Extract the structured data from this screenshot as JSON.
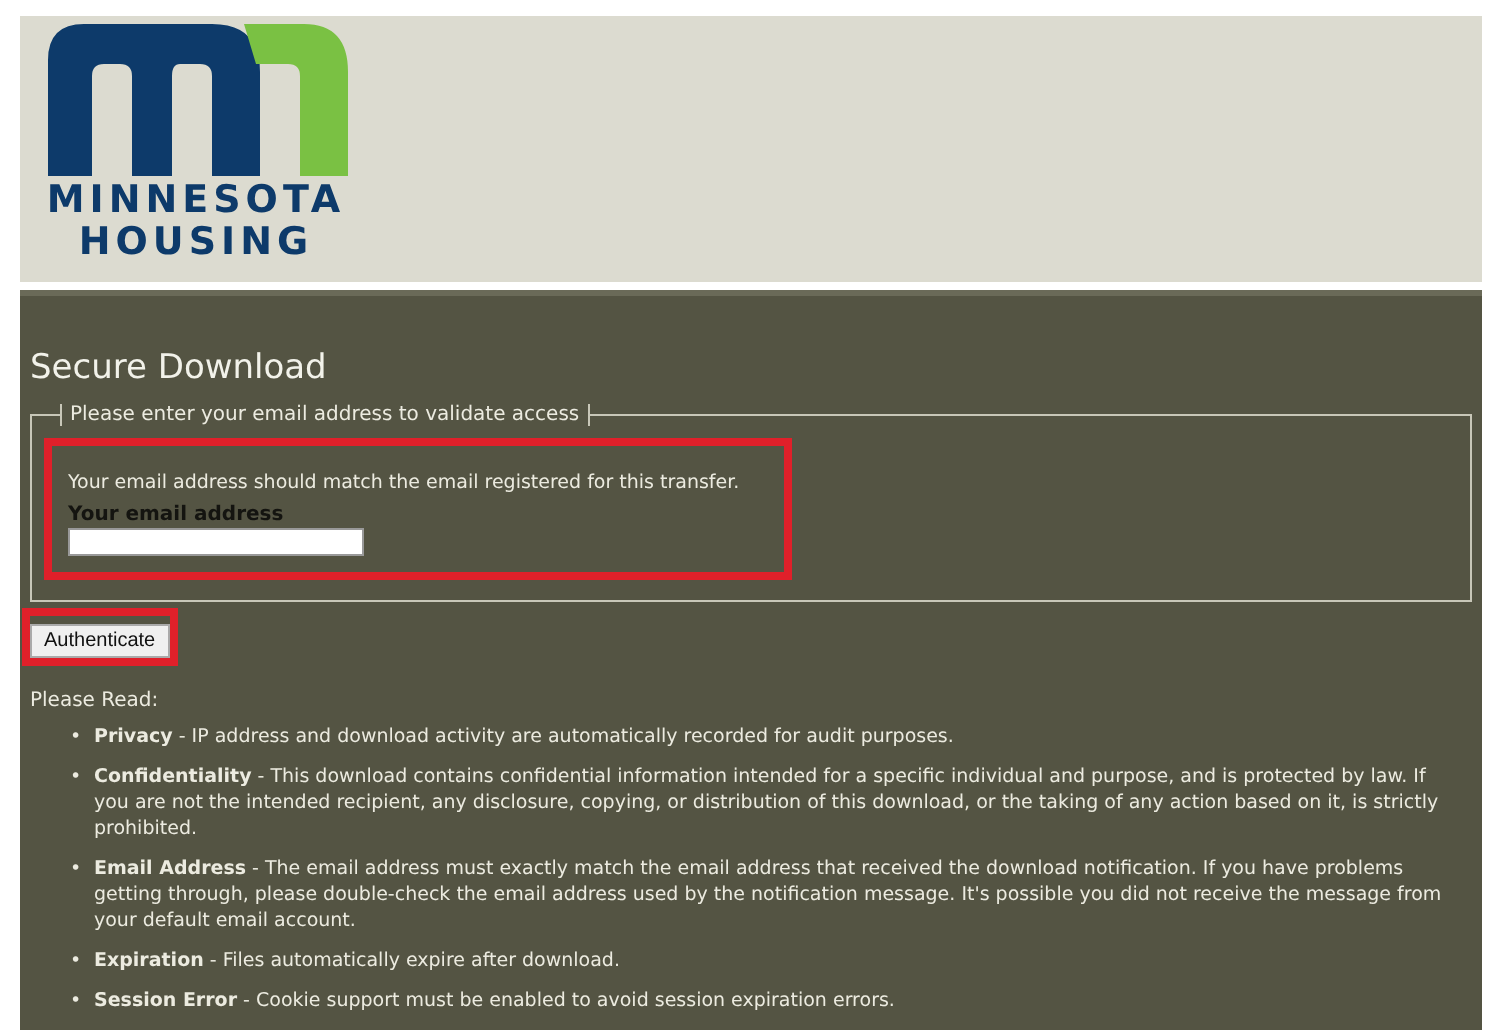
{
  "header": {
    "logo_lines": [
      "MINNESOTA",
      "HOUSING"
    ]
  },
  "title": "Secure Download",
  "form": {
    "legend": "Please enter your email address to validate access",
    "note": "Your email address should match the email registered for this transfer.",
    "field_label": "Your email address",
    "highlighted": true
  },
  "button": {
    "label": "Authenticate",
    "highlighted": true
  },
  "notice": {
    "heading": "Please Read:",
    "items": [
      {
        "bullet": "•",
        "text": "**Privacy** - IP address and download activity are automatically recorded for audit purposes."
      },
      {
        "bullet": "•",
        "text": "**Confidentiality** - This download contains confidential information intended for a specific individual and purpose, and is protected by law. If you are not the intended recipient, any disclosure, copying, or distribution of this download, or the taking of any action based on it, is strictly prohibited."
      },
      {
        "bullet": "•",
        "text": "**Email Address** - The email address must exactly match the email address that received the download notification. If you have problems getting through, please double-check the email address used by the notification message. It's possible you did not receive the message from your default email account."
      },
      {
        "bullet": "•",
        "text": "**Expiration** - Files automatically expire after download."
      },
      {
        "bullet": "•",
        "text": "**Session Error** - Cookie support must be enabled to avoid session expiration errors."
      }
    ]
  }
}
